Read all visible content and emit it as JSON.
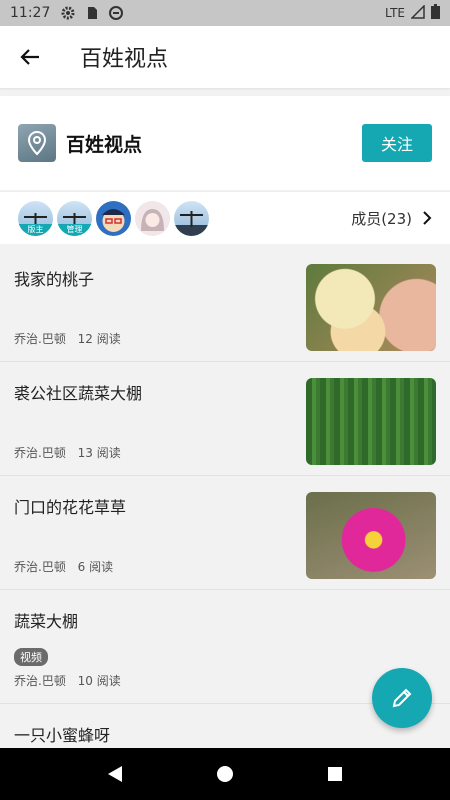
{
  "status_bar": {
    "time": "11:27",
    "network": "LTE"
  },
  "app_bar": {
    "title": "百姓视点"
  },
  "group": {
    "name": "百姓视点",
    "follow_label": "关注"
  },
  "members": {
    "avatars": [
      {
        "badge": "版主"
      },
      {
        "badge": "管理"
      },
      {
        "badge": ""
      },
      {
        "badge": ""
      },
      {
        "badge": ""
      }
    ],
    "label": "成员(23)"
  },
  "feed": [
    {
      "title": "我家的桃子",
      "author": "乔治.巴顿",
      "reads": "12 阅读",
      "thumb": "peach"
    },
    {
      "title": "裘公社区蔬菜大棚",
      "author": "乔治.巴顿",
      "reads": "13 阅读",
      "thumb": "field"
    },
    {
      "title": "门口的花花草草",
      "author": "乔治.巴顿",
      "reads": "6 阅读",
      "thumb": "flower"
    },
    {
      "title": "蔬菜大棚",
      "tag": "视频",
      "author": "乔治.巴顿",
      "reads": "10 阅读"
    },
    {
      "title": "一只小蜜蜂呀"
    }
  ],
  "colors": {
    "accent": "#16a8b2",
    "status_bar": "#c6c6c6"
  }
}
